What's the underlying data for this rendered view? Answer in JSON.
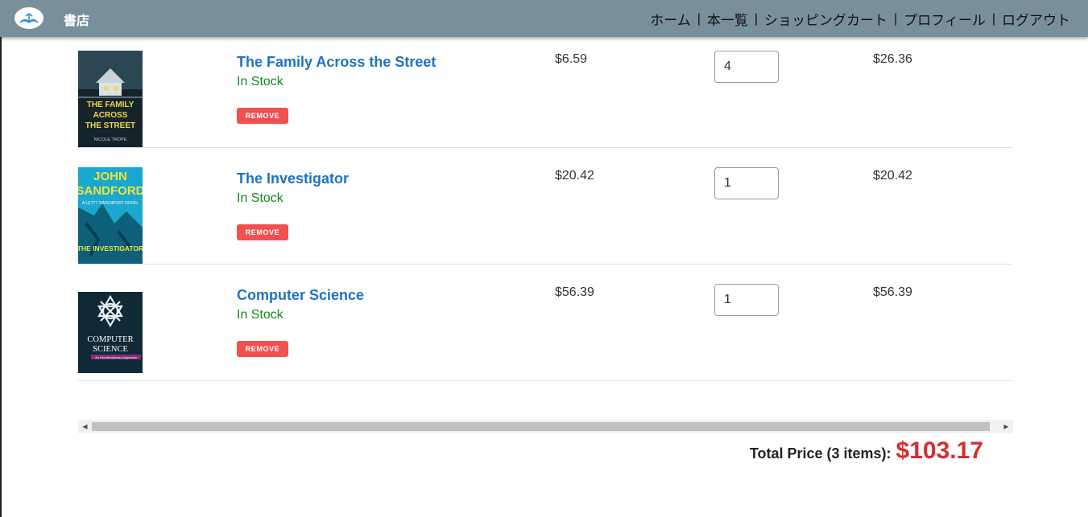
{
  "navbar": {
    "brand": "書店",
    "links": [
      "ホーム",
      "本一覧",
      "ショッピングカート",
      "プロフィール",
      "ログアウト"
    ],
    "separator": "|",
    "logo_icon": "open-book-icon",
    "background": "#78909c"
  },
  "cart": {
    "items": [
      {
        "title": "The Family Across the Street",
        "stock": "In Stock",
        "remove_label": "REMOVE",
        "price": "$6.59",
        "quantity": "4",
        "subtotal": "$26.36",
        "cover_text": [
          "THE FAMILY",
          "ACROSS",
          "THE STREET"
        ],
        "cover_author": "NICOLE TROPE"
      },
      {
        "title": "The Investigator",
        "stock": "In Stock",
        "remove_label": "REMOVE",
        "price": "$20.42",
        "quantity": "1",
        "subtotal": "$20.42",
        "cover_text": [
          "JOHN",
          "SANDFORD",
          "THE INVESTIGATOR"
        ],
        "cover_author": "A LETTY DAVENPORT NOVEL"
      },
      {
        "title": "Computer Science",
        "stock": "In Stock",
        "remove_label": "REMOVE",
        "price": "$56.39",
        "quantity": "1",
        "subtotal": "$56.39",
        "cover_text": [
          "COMPUTER",
          "SCIENCE"
        ],
        "cover_author": "An Interdisciplinary Approach"
      }
    ]
  },
  "summary": {
    "label": "Total Price (3 items):",
    "total": "$103.17",
    "total_color": "#d32f2f"
  },
  "colors": {
    "link": "#1e73be",
    "in_stock": "#138a13",
    "remove": "#f05050"
  }
}
